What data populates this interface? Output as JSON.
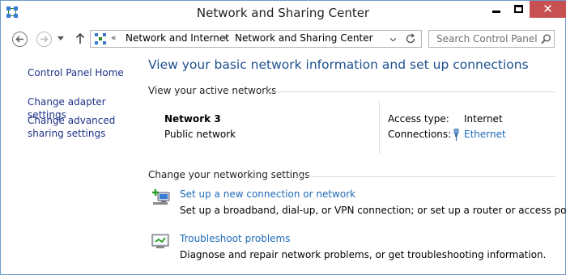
{
  "window": {
    "title": "Network and Sharing Center",
    "close_glyph": "✕"
  },
  "nav": {
    "back_icon": "back-arrow-icon",
    "forward_icon": "forward-arrow-icon",
    "up_icon": "up-arrow-icon"
  },
  "address": {
    "overflow": "«",
    "crumbs": [
      "Network and Internet",
      "Network and Sharing Center"
    ],
    "separator": "›"
  },
  "search": {
    "placeholder": "Search Control Panel"
  },
  "left_pane": {
    "home": "Control Panel Home",
    "adapter": "Change adapter settings",
    "advanced": "Change advanced sharing settings"
  },
  "main": {
    "title": "View your basic network information and set up connections",
    "active_header": "View your active networks",
    "network": {
      "name": "Network  3",
      "type": "Public network",
      "access_label": "Access type:",
      "access_value": "Internet",
      "connections_label": "Connections:",
      "connections_value": "Ethernet"
    },
    "change_header": "Change your networking settings",
    "tasks": [
      {
        "link": "Set up a new connection or network",
        "desc": "Set up a broadband, dial-up, or VPN connection; or set up a router or access point."
      },
      {
        "link": "Troubleshoot problems",
        "desc": "Diagnose and repair network problems, or get troubleshooting information."
      }
    ]
  },
  "colors": {
    "link": "#1e6bb8",
    "title": "#1e4f8f",
    "nav_link": "#1e3287",
    "close_button": "#c75050"
  }
}
